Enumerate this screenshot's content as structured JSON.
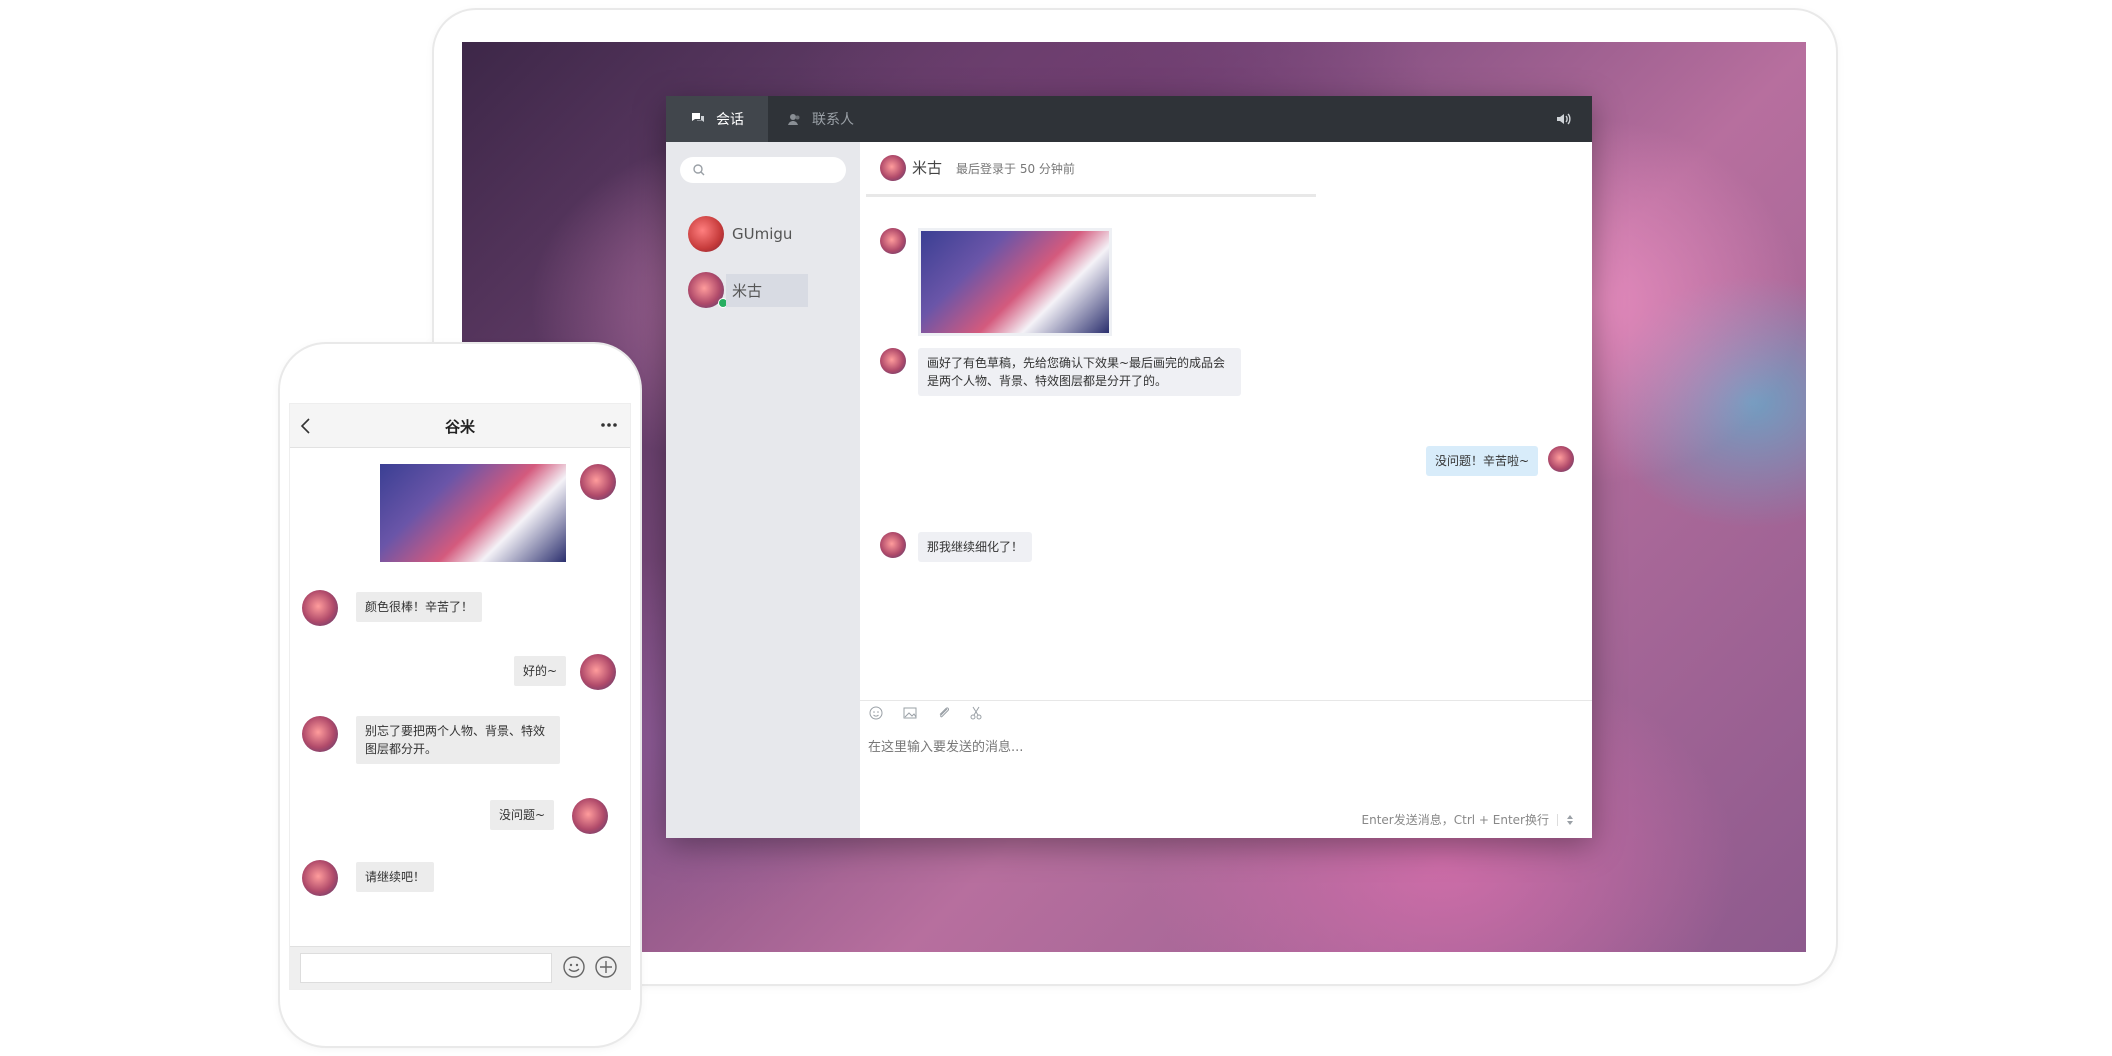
{
  "desktop": {
    "tabs": [
      {
        "label": "会话",
        "icon": "chat-bubbles-icon"
      },
      {
        "label": "联系人",
        "icon": "contacts-icon"
      }
    ],
    "speaker_icon": "speaker-icon",
    "search_placeholder": "",
    "contacts": [
      {
        "name": "GUmigu",
        "online": false
      },
      {
        "name": "米古",
        "online": true
      }
    ],
    "chat": {
      "header_name": "米古",
      "header_status": "最后登录于 50 分钟前",
      "messages": [
        {
          "type": "image",
          "from": "other"
        },
        {
          "type": "text",
          "from": "other",
          "text": "画好了有色草稿，先给您确认下效果~最后画完的成品会是两个人物、背景、特效图层都是分开了的。"
        },
        {
          "type": "text",
          "from": "me",
          "text": "没问题！辛苦啦~"
        },
        {
          "type": "text",
          "from": "other",
          "text": "那我继续细化了！"
        }
      ],
      "input_placeholder": "在这里输入要发送的消息...",
      "hint": "Enter发送消息，Ctrl + Enter换行"
    }
  },
  "mobile": {
    "title": "谷米",
    "messages": [
      {
        "type": "image",
        "from": "me"
      },
      {
        "type": "text",
        "from": "other",
        "text": "颜色很棒！辛苦了！"
      },
      {
        "type": "text",
        "from": "me",
        "text": "好的~"
      },
      {
        "type": "text",
        "from": "other",
        "text": "别忘了要把两个人物、背景、特效图层都分开。"
      },
      {
        "type": "text",
        "from": "me",
        "text": "没问题~"
      },
      {
        "type": "text",
        "from": "other",
        "text": "请继续吧！"
      }
    ]
  },
  "colors": {
    "topbar": "#2f3338",
    "sidebar": "#e7e8ec",
    "bubble_other": "#eff0f4",
    "bubble_me": "#d8ecfa",
    "online": "#27ae60"
  }
}
